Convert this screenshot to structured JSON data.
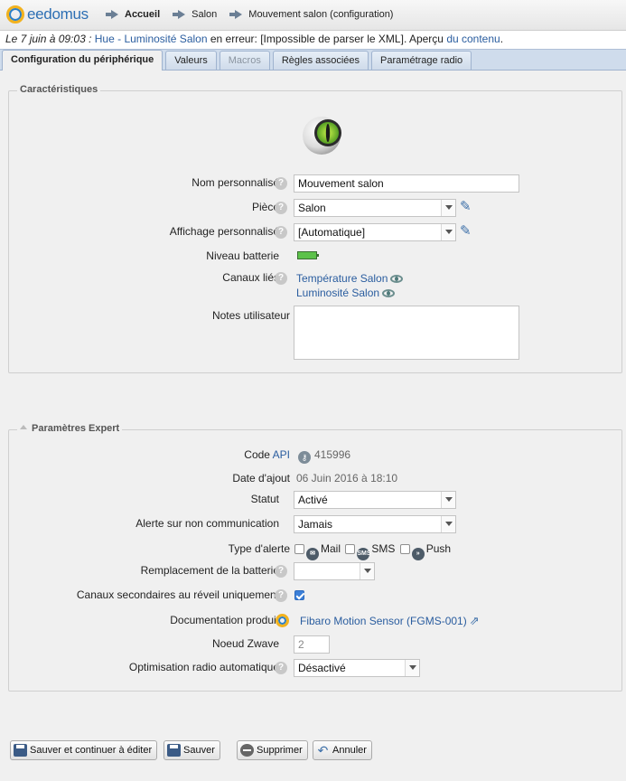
{
  "brand": {
    "name": "eedomus"
  },
  "breadcrumb": [
    {
      "label": "Accueil"
    },
    {
      "label": "Salon"
    },
    {
      "label": "Mouvement salon (configuration)"
    }
  ],
  "notice": {
    "date": "Le 7 juin à 09:03 :",
    "device": "Hue - Luminosité Salon",
    "message": "en erreur: [Impossible de parser le XML]. Aperçu",
    "link": "du contenu",
    "tail": "."
  },
  "tabs": [
    {
      "label": "Configuration du périphérique",
      "active": true
    },
    {
      "label": "Valeurs"
    },
    {
      "label": "Macros",
      "disabled": true
    },
    {
      "label": "Règles associées"
    },
    {
      "label": "Paramétrage radio"
    }
  ],
  "characteristics": {
    "legend": "Caractéristiques",
    "name_label": "Nom personnalisé",
    "name_value": "Mouvement salon",
    "room_label": "Pièce",
    "room_value": "Salon",
    "display_label": "Affichage personnalisé",
    "display_value": "[Automatique]",
    "battery_label": "Niveau batterie",
    "battery_level": 100,
    "channels_label": "Canaux liés",
    "channels": [
      "Température Salon",
      "Luminosité Salon"
    ],
    "notes_label": "Notes utilisateur",
    "notes_value": ""
  },
  "expert": {
    "legend": "Paramètres Expert",
    "code_label": "Code",
    "code_api": "API",
    "code_value": "415996",
    "added_label": "Date d'ajout",
    "added_value": "06 Juin 2016 à 18:10",
    "status_label": "Statut",
    "status_value": "Activé",
    "alert_label": "Alerte sur non communication",
    "alert_value": "Jamais",
    "alert_type_label": "Type d'alerte",
    "alert_types": [
      {
        "label": "Mail",
        "icon": "mail-icon"
      },
      {
        "label": "SMS",
        "icon": "sms-icon",
        "icon_text": "SMS"
      },
      {
        "label": "Push",
        "icon": "push-icon"
      }
    ],
    "battery_repl_label": "Remplacement de la batterie",
    "battery_repl_value": "",
    "secondary_label": "Canaux secondaires au réveil uniquement",
    "secondary_checked": true,
    "doc_label": "Documentation produit",
    "doc_link": "Fibaro Motion Sensor (FGMS-001)",
    "node_label": "Noeud Zwave",
    "node_value": "2",
    "radio_label": "Optimisation radio automatique",
    "radio_value": "Désactivé"
  },
  "buttons": {
    "save_continue": "Sauver et continuer à éditer",
    "save": "Sauver",
    "delete": "Supprimer",
    "cancel": "Annuler"
  },
  "colors": {
    "link": "#2a5d9f",
    "tab_bg": "#cfdcec",
    "accent": "#3b7fd8"
  }
}
